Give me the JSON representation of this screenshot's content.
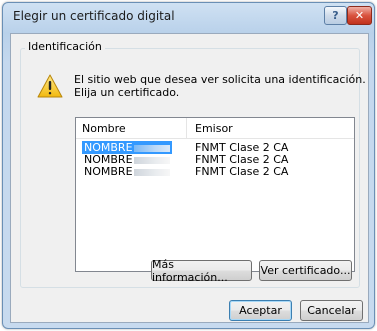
{
  "window": {
    "title": "Elegir un certificado digital",
    "help_glyph": "?",
    "close_glyph": "✕"
  },
  "group": {
    "label": "Identificación"
  },
  "message": {
    "line1": "El sitio web que desea ver solicita una identificación.",
    "line2": "Elija un certificado."
  },
  "list": {
    "columns": [
      "Nombre",
      "Emisor"
    ],
    "rows": [
      {
        "name": "NOMBRE",
        "issuer": "FNMT Clase 2 CA",
        "selected": true
      },
      {
        "name": "NOMBRE",
        "issuer": "FNMT Clase 2 CA",
        "selected": false
      },
      {
        "name": "NOMBRE",
        "issuer": "FNMT Clase 2 CA",
        "selected": false
      }
    ]
  },
  "buttons": {
    "more_info": "Más información...",
    "view_cert": "Ver certificado...",
    "accept": "Aceptar",
    "cancel": "Cancelar"
  },
  "colors": {
    "selection": "#3399ff",
    "accent": "#3c7fb1"
  },
  "icons": {
    "warning": "warning-icon"
  }
}
